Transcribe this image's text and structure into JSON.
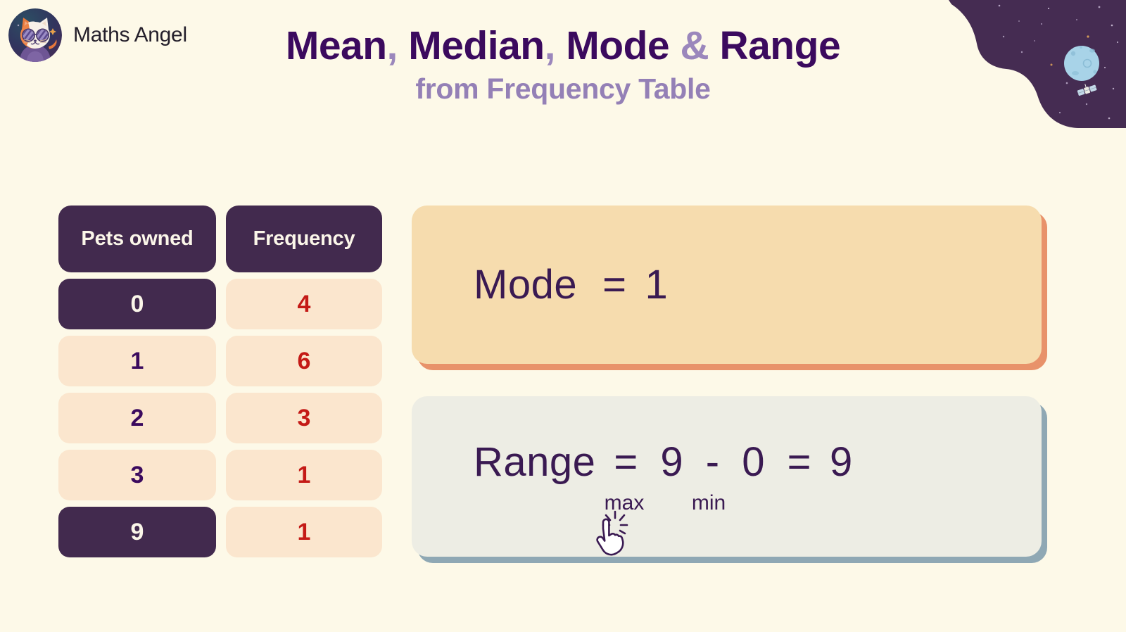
{
  "brand": {
    "name": "Maths Angel",
    "avatar_icon": "cat-avatar-icon"
  },
  "header": {
    "title_part1": "Mean",
    "title_comma1": ",",
    "title_part2": " Median",
    "title_comma2": ",",
    "title_part3": " Mode ",
    "title_amp": "&",
    "title_part4": " Range",
    "subtitle": "from Frequency Table"
  },
  "decor": {
    "space_blob_icon": "space-blob-icon",
    "moon_icon": "moon-icon",
    "satellite_icon": "satellite-icon"
  },
  "table": {
    "headers": [
      "Pets owned",
      "Frequency"
    ],
    "rows": [
      {
        "pets": "0",
        "frequency": "4",
        "pets_highlight": true,
        "freq_highlight": false
      },
      {
        "pets": "1",
        "frequency": "6",
        "pets_highlight": false,
        "freq_highlight": false
      },
      {
        "pets": "2",
        "frequency": "3",
        "pets_highlight": false,
        "freq_highlight": false
      },
      {
        "pets": "3",
        "frequency": "1",
        "pets_highlight": false,
        "freq_highlight": false
      },
      {
        "pets": "9",
        "frequency": "1",
        "pets_highlight": true,
        "freq_highlight": false
      }
    ]
  },
  "cards": {
    "mode": {
      "label": "Mode",
      "equals": "=",
      "value": "1",
      "bg_color": "#F6DCAE",
      "shadow_color": "#E8926A"
    },
    "range": {
      "label": "Range",
      "equals1": "=",
      "max_value": "9",
      "minus": "-",
      "min_value": "0",
      "equals2": "=",
      "result": "9",
      "max_label": "max",
      "min_label": "min",
      "bg_color": "#EDEDE4",
      "shadow_color": "#8FA8B4"
    }
  },
  "cursor": {
    "icon": "click-hand-cursor-icon"
  },
  "colors": {
    "background": "#FDF9E8",
    "title_dark": "#3B0A5E",
    "title_accent": "#9B87BC",
    "subtitle": "#9480B6",
    "table_header_bg": "#422A4E",
    "table_cell_bg": "#FBE6CE",
    "frequency_text": "#C41A16",
    "pets_text": "#3B0A5E"
  }
}
